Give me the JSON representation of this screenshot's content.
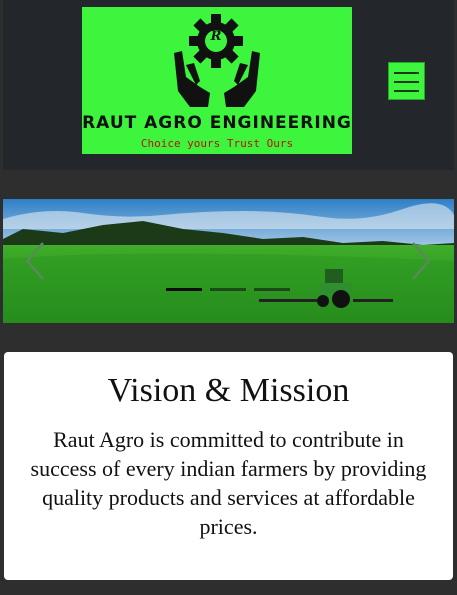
{
  "header": {
    "logo": {
      "title": "RAUT AGRO ENGINEERING",
      "tagline": "Choice yours Trust Ours",
      "emblem_letter": "R",
      "colors": {
        "background": "#3cf53c",
        "title": "#111111",
        "tagline": "#c01010"
      }
    },
    "menu_icon": "hamburger-menu-icon"
  },
  "carousel": {
    "slide_count": 3,
    "active_index": 0,
    "prev_icon": "chevron-left-icon",
    "next_icon": "chevron-right-icon"
  },
  "vision": {
    "title": "Vision & Mission",
    "text": "Raut Agro is committed to contribute in success of every indian farmers by providing quality products and services at affordable prices."
  }
}
